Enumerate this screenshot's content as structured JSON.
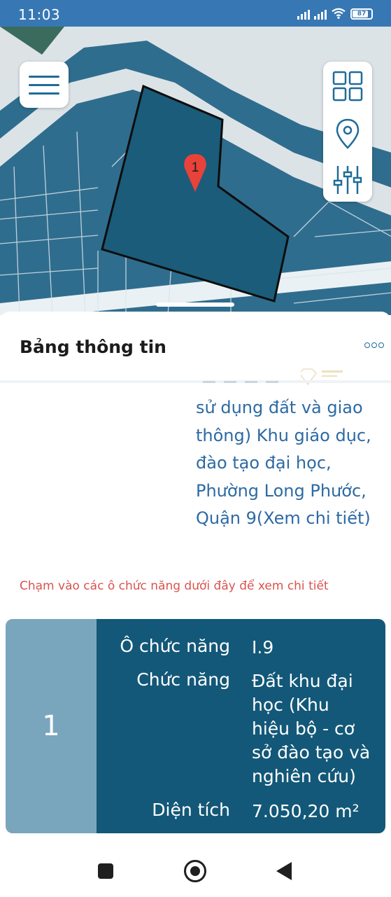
{
  "status_bar": {
    "time": "11:03",
    "battery_level": "87",
    "icons": [
      "signal-icon",
      "signal-icon",
      "wifi-icon",
      "battery-icon"
    ]
  },
  "map": {
    "marker_label": "1",
    "colors": {
      "map_fill": "#2f6d8e",
      "road": "#e9ecee",
      "park": "#3b6b5c",
      "parcel": "#1a5c7a",
      "marker": "#e8423a"
    },
    "toolbar_icons": [
      "grid-icon",
      "location-pin-icon",
      "sliders-icon"
    ]
  },
  "panel": {
    "title": "Bảng thông tin",
    "description_lines": [
      "sử dụng đất và giao",
      "thông) Khu giáo dục,",
      "đào tạo đại học,",
      "Phường Long Phước,",
      "Quận 9(Xem chi tiết)"
    ],
    "hint": "Chạm vào các ô chức năng dưới đây để xem chi tiết"
  },
  "card": {
    "number": "1",
    "rows": [
      {
        "label": "Ô chức năng",
        "value_lines": [
          "I.9"
        ]
      },
      {
        "label": "Chức năng",
        "value_lines": [
          "Đất khu đại",
          "học (Khu",
          "hiệu bộ - cơ",
          "sở đào tạo và",
          "nghiên cứu)"
        ]
      },
      {
        "label": "Diện tích",
        "value_lines": [
          "7.050,20 m²"
        ]
      }
    ],
    "colors": {
      "left": "#7aa6bd",
      "right": "#135878"
    }
  },
  "navbar": {
    "icons": [
      "recents-square-icon",
      "home-circle-icon",
      "back-triangle-icon"
    ]
  }
}
